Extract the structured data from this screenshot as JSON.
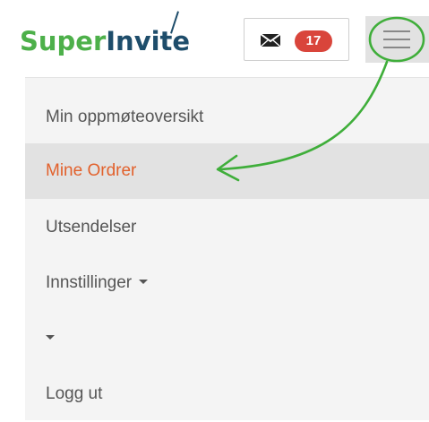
{
  "logo": {
    "part1": "Super",
    "part2": "Invite"
  },
  "header": {
    "mail_icon": "envelope-icon",
    "unread_count": "17",
    "menu_icon": "hamburger-icon"
  },
  "nav": {
    "items": [
      {
        "label": "Min oppmøteoversikt",
        "active": false
      },
      {
        "label": "Mine Ordrer",
        "active": true
      },
      {
        "label": "Utsendelser",
        "active": false
      },
      {
        "label": "Innstillinger",
        "active": false,
        "dropdown": true
      },
      {
        "label": "",
        "active": false,
        "dropdown": true
      },
      {
        "label": "Logg ut",
        "active": false
      }
    ]
  },
  "colors": {
    "brand_green": "#4db04a",
    "brand_navy": "#1e4d6b",
    "badge_red": "#d9453b",
    "active_orange": "#e2612c",
    "annotation_green": "#3fae3a"
  }
}
